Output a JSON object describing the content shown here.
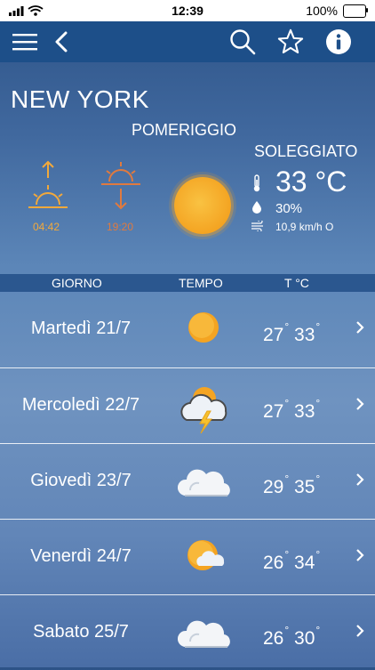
{
  "status_bar": {
    "time": "12:39",
    "battery": "100%"
  },
  "header": {
    "city": "NEW YORK",
    "daypart": "POMERIGGIO",
    "condition": "SOLEGGIATO",
    "sunrise": "04:42",
    "sunset": "19:20",
    "temperature": "33 °C",
    "humidity": "30%",
    "wind": "10,9 km/h O"
  },
  "table": {
    "col_day": "GIORNO",
    "col_weather": "TEMPO",
    "col_temp": "T °C"
  },
  "forecast": [
    {
      "day": "Martedì 21/7",
      "min": "27",
      "max": "33",
      "icon": "sun-icon"
    },
    {
      "day": "Mercoledì 22/7",
      "min": "27",
      "max": "33",
      "icon": "thunderstorm-icon"
    },
    {
      "day": "Giovedì 23/7",
      "min": "29",
      "max": "35",
      "icon": "cloud-icon"
    },
    {
      "day": "Venerdì 24/7",
      "min": "26",
      "max": "34",
      "icon": "sun-cloud-icon"
    },
    {
      "day": "Sabato 25/7",
      "min": "26",
      "max": "30",
      "icon": "cloud-icon"
    }
  ],
  "colors": {
    "navbar": "#1d4f89",
    "sunrise": "#f2a93b",
    "sunset": "#e07a3f",
    "sun": "#f4a422"
  }
}
